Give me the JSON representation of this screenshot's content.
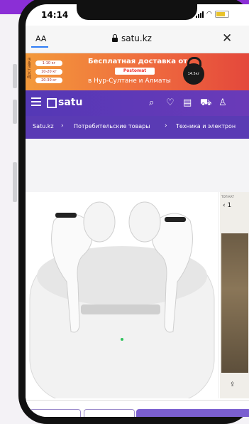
{
  "status_bar": {
    "time": "14:14"
  },
  "browser": {
    "text_size_label": "AA",
    "url": "satu.kz",
    "close_glyph": "✕"
  },
  "banner": {
    "side_text": "Доставка",
    "pills": [
      "1-10 кг",
      "10-20 кг",
      "20-30 кг"
    ],
    "line1": "Бесплатная доставка от",
    "logo": "Postomat",
    "line3": "в Нур-Султане и Алматы",
    "badge": "14.5кг"
  },
  "site_header": {
    "logo": "satu",
    "icons": [
      "search-icon",
      "heart-icon",
      "chat-icon",
      "cart-icon",
      "user-icon"
    ]
  },
  "breadcrumb": {
    "items": [
      "Satu.kz",
      "Потребительские товары",
      "Техника и электрон"
    ],
    "separator": "›"
  },
  "product": {
    "thumb_label": "ТОП КАТ",
    "thumb_nav": "‹ 1",
    "share_glyph": "⇪"
  },
  "colors": {
    "brand_purple": "#5438b6",
    "banner_orange": "#ef6b3e",
    "promo_purple": "#8b2fd6"
  }
}
